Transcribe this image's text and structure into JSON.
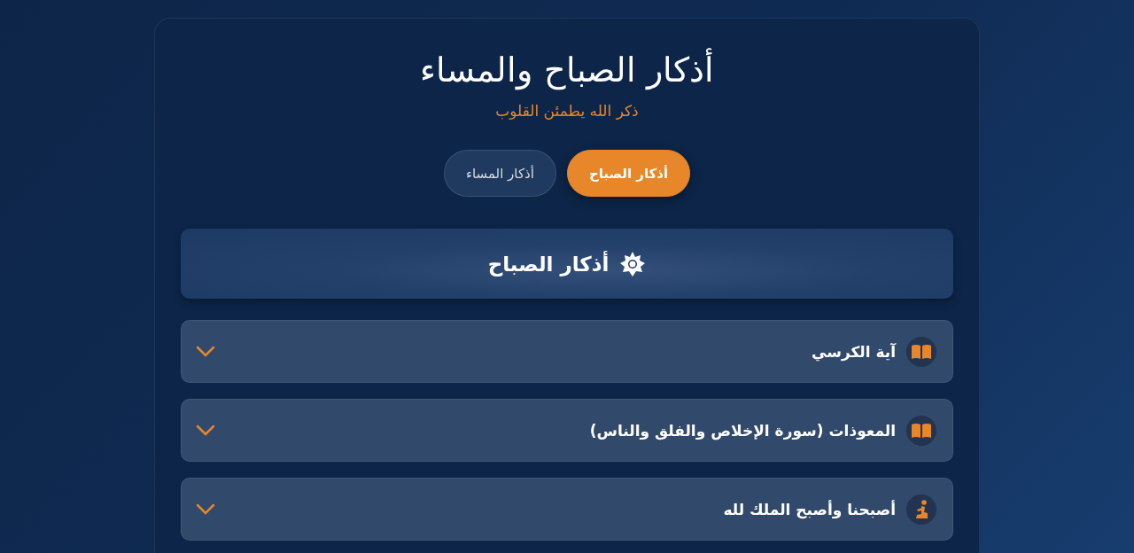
{
  "title": "أذكار الصباح والمساء",
  "subtitle": "ذكر الله يطمئن القلوب",
  "tabs": [
    {
      "label": "أذكار الصباح",
      "selected": true
    },
    {
      "label": "أذكار المساء",
      "selected": false
    }
  ],
  "section": {
    "title": "أذكار الصباح"
  },
  "items": [
    {
      "kind": "book",
      "title": "آية الكرسي",
      "expanded": false
    },
    {
      "kind": "book",
      "title": "المعوذات (سورة الإخلاص والفلق والناس)",
      "expanded": false
    },
    {
      "kind": "prayer",
      "title": "أصبحنا وأصبح الملك لله",
      "expanded": false
    }
  ]
}
